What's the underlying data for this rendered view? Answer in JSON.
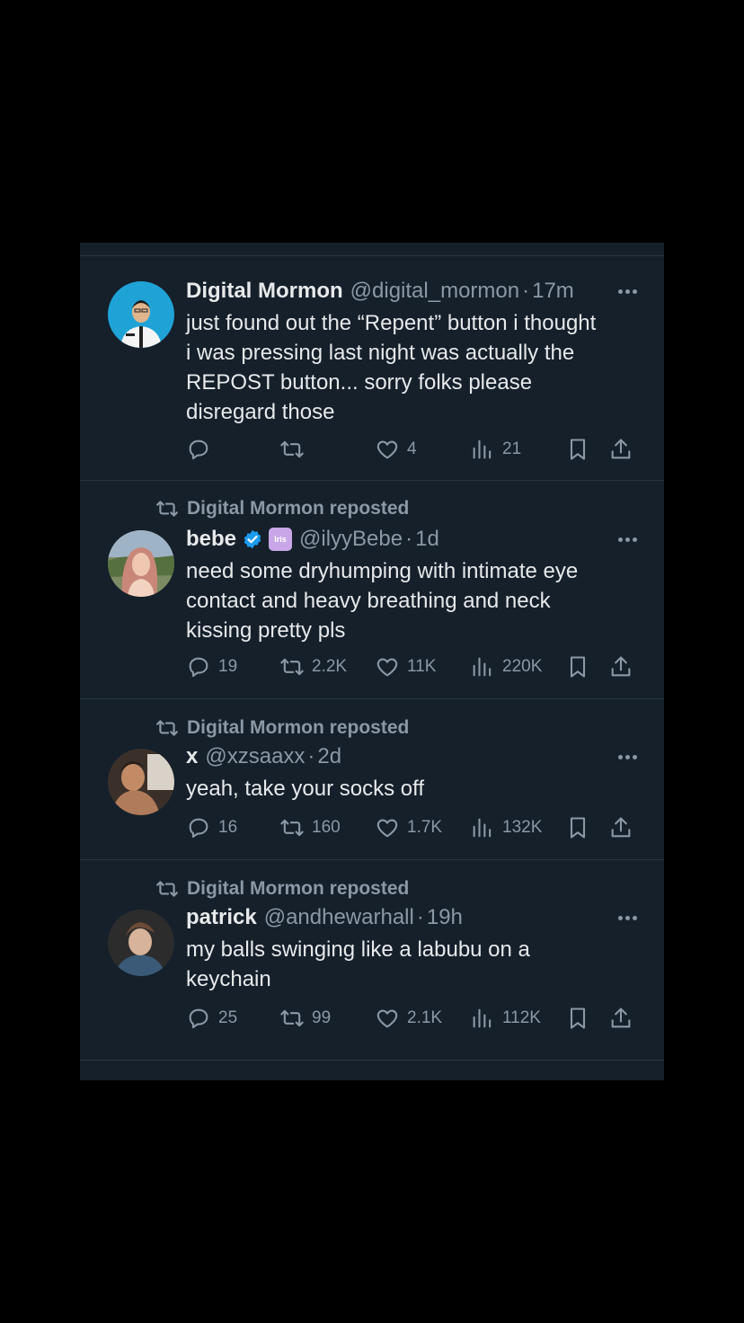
{
  "theme": {
    "background": "#15202b",
    "text": "#e7e9ea",
    "muted": "#8b98a5",
    "divider": "#2a3642",
    "verified": "#1d9bf0"
  },
  "tweets": [
    {
      "reposted_by": "",
      "name": "Digital Mormon",
      "handle": "@digital_mormon",
      "sep": "·",
      "time": "17m",
      "text_lines": [
        "just found out the “Repent” button i thought",
        "i was pressing last night was actually the",
        "REPOST button... sorry folks please",
        "disregard those"
      ],
      "replies": "",
      "reposts": "",
      "likes": "4",
      "views": "21"
    },
    {
      "reposted_by": "Digital Mormon reposted",
      "name": "bebe",
      "handle": "@ilyyBebe",
      "sep": "·",
      "time": "1d",
      "text_lines": [
        "need some dryhumping with intimate eye",
        "contact and heavy breathing and neck",
        "kissing pretty pls"
      ],
      "replies": "19",
      "reposts": "2.2K",
      "likes": "11K",
      "views": "220K",
      "badge_text": "Iris"
    },
    {
      "reposted_by": "Digital Mormon reposted",
      "name": "x",
      "handle": "@xzsaaxx",
      "sep": "·",
      "time": "2d",
      "text_lines": [
        "yeah, take your socks off"
      ],
      "replies": "16",
      "reposts": "160",
      "likes": "1.7K",
      "views": "132K"
    },
    {
      "reposted_by": "Digital Mormon reposted",
      "name": "patrick",
      "handle": "@andhewarhall",
      "sep": "·",
      "time": "19h",
      "text_lines": [
        "my balls swinging like a labubu on a",
        "keychain"
      ],
      "replies": "25",
      "reposts": "99",
      "likes": "2.1K",
      "views": "112K"
    }
  ]
}
